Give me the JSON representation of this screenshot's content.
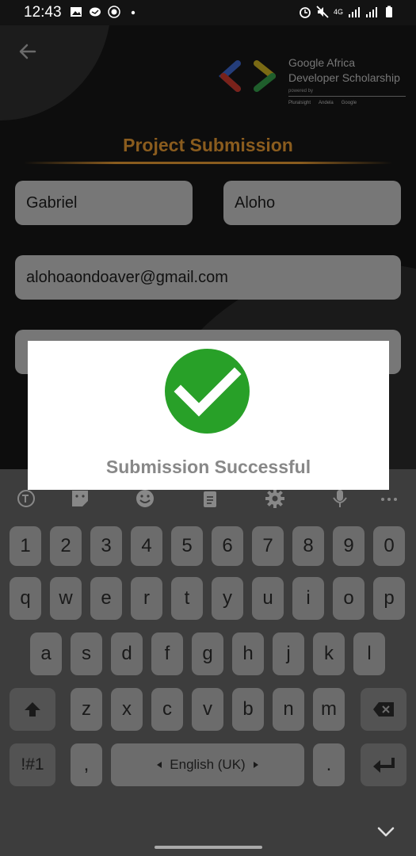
{
  "status_bar": {
    "time": "12:43",
    "network": "4G"
  },
  "app": {
    "logo": {
      "title_line1": "Google Africa",
      "title_line2": "Developer Scholarship",
      "powered_by": "powered by",
      "partners": [
        "Pluralsight",
        "Andela",
        "Google"
      ]
    },
    "page_title": "Project Submission",
    "first_name": "Gabriel",
    "last_name": "Aloho",
    "email": "alohoaondoaver@gmail.com"
  },
  "dialog": {
    "message": "Submission Successful"
  },
  "keyboard": {
    "number_row": [
      "1",
      "2",
      "3",
      "4",
      "5",
      "6",
      "7",
      "8",
      "9",
      "0"
    ],
    "row1": [
      "q",
      "w",
      "e",
      "r",
      "t",
      "y",
      "u",
      "i",
      "o",
      "p"
    ],
    "row2": [
      "a",
      "s",
      "d",
      "f",
      "g",
      "h",
      "j",
      "k",
      "l"
    ],
    "row3": [
      "z",
      "x",
      "c",
      "v",
      "b",
      "n",
      "m"
    ],
    "symbols_label": "!#1",
    "comma": ",",
    "period": ".",
    "space_label": "English (UK)"
  },
  "colors": {
    "accent": "#8a5c1e",
    "success": "#28a028",
    "keyboard_bg": "#3d3d3d",
    "key": "#6c6c6c"
  }
}
